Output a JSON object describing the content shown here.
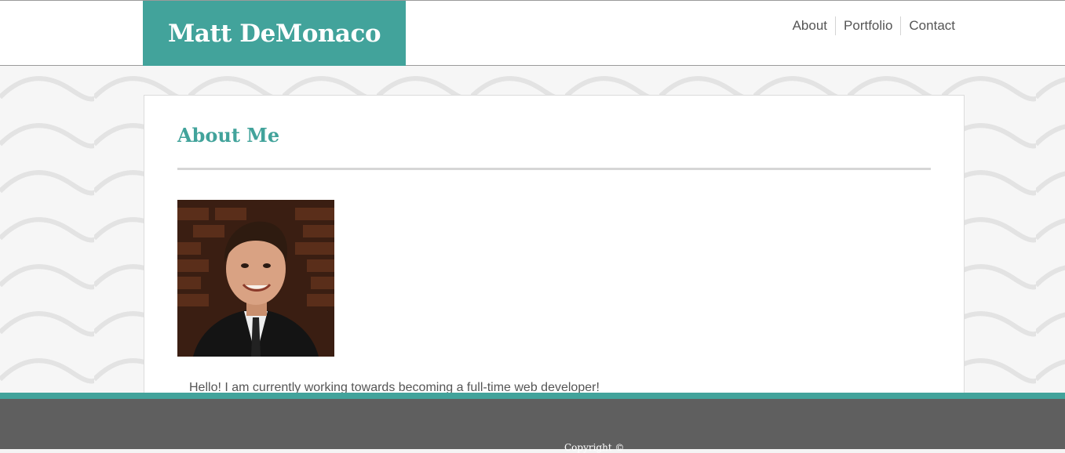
{
  "header": {
    "brand": "Matt DeMonaco",
    "nav": [
      {
        "label": "About"
      },
      {
        "label": "Portfolio"
      },
      {
        "label": "Contact"
      }
    ]
  },
  "main": {
    "title": "About Me",
    "photo_alt": "Portrait of Matt DeMonaco",
    "intro": "Hello! I am currently working towards becoming a full-time web developer!"
  },
  "footer": {
    "copyright": "Copyright ©"
  },
  "colors": {
    "accent": "#42a39b",
    "footer": "#5f5f5f",
    "page_background": "#f4f4f4"
  }
}
